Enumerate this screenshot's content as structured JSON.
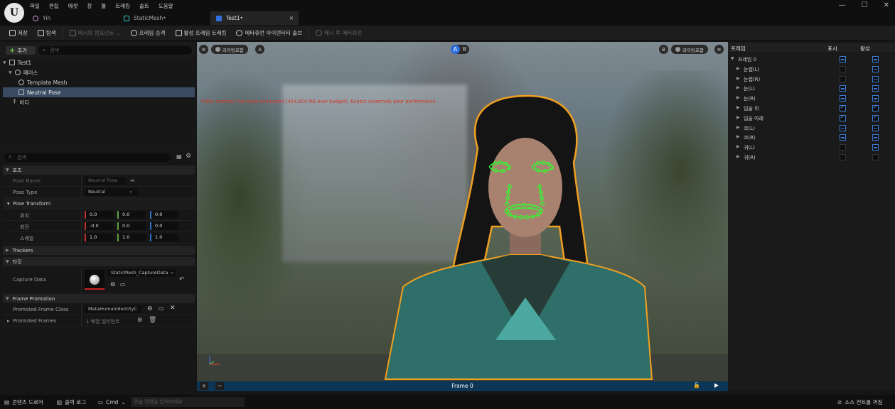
{
  "menu": [
    "파일",
    "편집",
    "에셋",
    "창",
    "툴",
    "트래킹",
    "솔트",
    "도움말"
  ],
  "tabs": [
    {
      "label": "Yin",
      "active": false
    },
    {
      "label": "StaticMesh•",
      "active": false
    },
    {
      "label": "Test1•",
      "active": true
    }
  ],
  "tab_close": "×",
  "window_controls": {
    "min": "—",
    "max": "☐",
    "close": "✕"
  },
  "toolbar": {
    "save": "저장",
    "browse": "탐색",
    "mesh_component": "메시의 컴포넌트",
    "promote_frame": "프레임 승격",
    "active_frame_tracking": "활성 프레임 트래킹",
    "metahuman_solve": "메타휴먼 아이덴티티 솔브",
    "mesh_to_metahuman": "메시 투 메타휴먼"
  },
  "left": {
    "add_label": "추가",
    "search_placeholder": "검색",
    "tree": [
      {
        "label": "Test1",
        "indent": 0,
        "selected": false
      },
      {
        "label": "페이스",
        "indent": 1,
        "selected": false
      },
      {
        "label": "Template Mesh",
        "indent": 2,
        "selected": false
      },
      {
        "label": "Neutral Pose",
        "indent": 2,
        "selected": true
      },
      {
        "label": "바디",
        "indent": 1,
        "selected": false
      }
    ],
    "details_search_placeholder": "검색",
    "sections": {
      "pose": "포즈",
      "pose_name_label": "Pose Name",
      "pose_name_value": "Neutral Pose",
      "pose_type_label": "Pose Type",
      "pose_type_value": "Neutral",
      "pose_transform": "Pose Transform",
      "location_label": "위치",
      "location": [
        "0.0",
        "0.0",
        "0.0"
      ],
      "rotation_label": "회전",
      "rotation": [
        "-0.0",
        "0.0",
        "0.0"
      ],
      "scale_label": "스케일",
      "scale": [
        "1.0",
        "1.0",
        "1.0"
      ],
      "trackers": "Trackers",
      "target": "타깃",
      "capture_data_label": "Capture Data",
      "capture_data_value": "StaticMesh_CaptureData",
      "frame_promotion": "Frame Promotion",
      "promoted_frame_class_label": "Promoted Frame Class",
      "promoted_frame_class_value": "MetaHumanIdentityC",
      "promoted_frames_label": "Promoted Frames",
      "promoted_frames_value": "1 배열 엘리먼트"
    }
  },
  "viewport": {
    "lighting_label": "라이팅포함",
    "ab_left": "A",
    "ab_right": "B",
    "warning": "Video memory has been exhausted (454.604 MB over budget). Expect extremely poor performance.",
    "frame_label": "Frame 0"
  },
  "right": {
    "col_frame": "프레임",
    "col_show": "표시",
    "col_active": "활성",
    "rows": [
      {
        "label": "프레임 0",
        "indent": 0,
        "show": "on",
        "active": "on"
      },
      {
        "label": "눈썹(L)",
        "indent": 1,
        "show": "off",
        "active": "on"
      },
      {
        "label": "눈썹(R)",
        "indent": 1,
        "show": "off",
        "active": "on"
      },
      {
        "label": "눈(L)",
        "indent": 1,
        "show": "on",
        "active": "on"
      },
      {
        "label": "눈(R)",
        "indent": 1,
        "show": "on",
        "active": "on"
      },
      {
        "label": "입술 위",
        "indent": 1,
        "show": "chk",
        "active": "chk"
      },
      {
        "label": "입술 아래",
        "indent": 1,
        "show": "chk",
        "active": "chk"
      },
      {
        "label": "코(L)",
        "indent": 1,
        "show": "on",
        "active": "on"
      },
      {
        "label": "코(R)",
        "indent": 1,
        "show": "on",
        "active": "on"
      },
      {
        "label": "귀(L)",
        "indent": 1,
        "show": "off",
        "active": "on"
      },
      {
        "label": "귀(R)",
        "indent": 1,
        "show": "off",
        "active": "off"
      }
    ]
  },
  "status": {
    "content_drawer": "콘텐츠 드로어",
    "output_log": "출력 로그",
    "cmd": "Cmd",
    "cmd_placeholder": "콘솔 명령을 입력하세요",
    "source_control": "소스 컨트롤 꺼짐"
  }
}
